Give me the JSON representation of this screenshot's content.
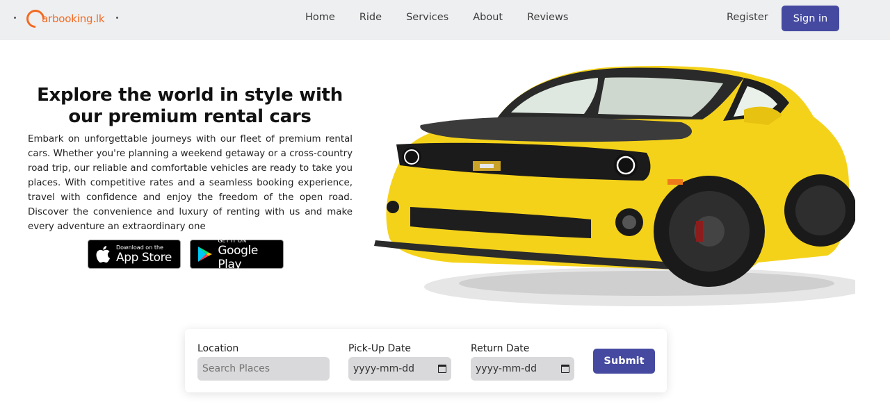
{
  "brand": {
    "name": "arbooking.lk",
    "color": "#f26a21"
  },
  "nav": {
    "links": [
      "Home",
      "Ride",
      "Services",
      "About",
      "Reviews"
    ],
    "register": "Register",
    "signin": "Sign in"
  },
  "hero": {
    "title": "Explore the world in style with our premium rental cars",
    "description": "Embark on unforgettable journeys with our fleet of premium rental cars. Whether you're planning a weekend getaway or a cross-country road trip, our reliable and comfortable vehicles are ready to take you places. With competitive rates and a seamless booking experience, travel with confidence and enjoy the freedom of the open road. Discover the convenience and luxury of renting with us and make every adventure an extraordinary one"
  },
  "stores": {
    "appstore": {
      "small": "Download on the",
      "big": "App Store",
      "icon": "apple-icon"
    },
    "googleplay": {
      "small": "GET IT ON",
      "big": "Google Play",
      "icon": "google-play-icon"
    }
  },
  "search": {
    "location_label": "Location",
    "location_placeholder": "Search Places",
    "pickup_label": "Pick-Up Date",
    "pickup_value": "yyyy-mm-dd",
    "return_label": "Return Date",
    "return_value": "yyyy-mm-dd",
    "submit": "Submit"
  },
  "colors": {
    "accent": "#454aa0",
    "navbar": "#eeeff1",
    "car": "#f5d21a"
  }
}
